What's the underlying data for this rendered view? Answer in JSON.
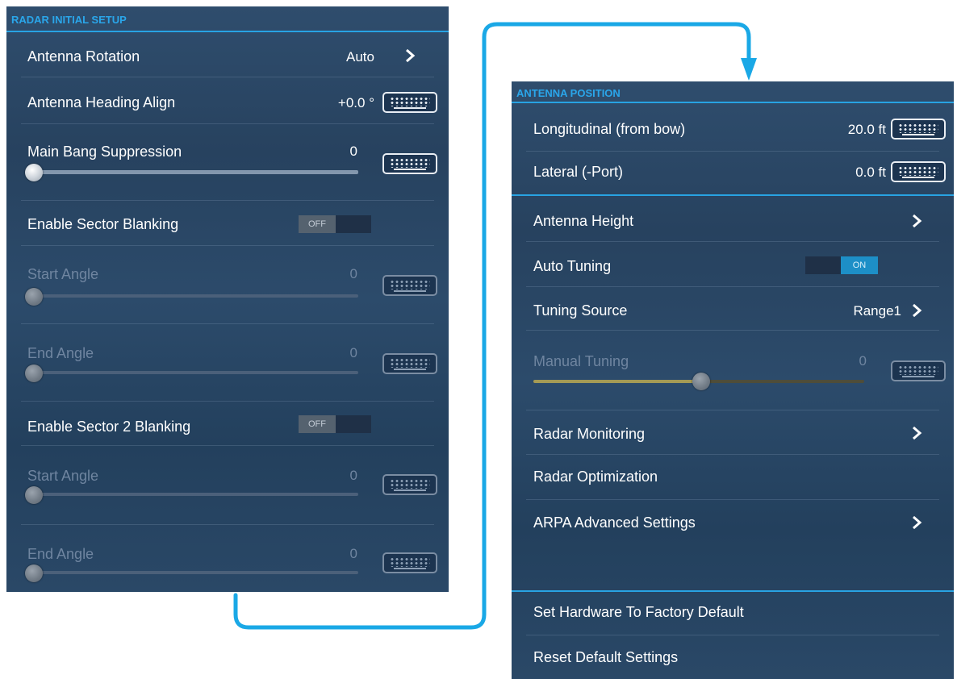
{
  "left_panel": {
    "title": "RADAR INITIAL SETUP",
    "antenna_rotation": {
      "label": "Antenna Rotation",
      "value": "Auto"
    },
    "antenna_heading_align": {
      "label": "Antenna Heading Align",
      "value": "+0.0 °"
    },
    "main_bang_suppression": {
      "label": "Main Bang Suppression",
      "value": "0"
    },
    "enable_sector_blanking": {
      "label": "Enable Sector Blanking",
      "toggle": "OFF"
    },
    "start_angle_1": {
      "label": "Start Angle",
      "value": "0"
    },
    "end_angle_1": {
      "label": "End Angle",
      "value": "0"
    },
    "enable_sector_2_blanking": {
      "label": "Enable Sector 2 Blanking",
      "toggle": "OFF"
    },
    "start_angle_2": {
      "label": "Start Angle",
      "value": "0"
    },
    "end_angle_2": {
      "label": "End Angle",
      "value": "0"
    }
  },
  "right_panel": {
    "title": "ANTENNA POSITION",
    "longitudinal": {
      "label": "Longitudinal (from bow)",
      "value": "20.0 ft"
    },
    "lateral": {
      "label": "Lateral (-Port)",
      "value": "0.0 ft"
    },
    "antenna_height": {
      "label": "Antenna Height"
    },
    "auto_tuning": {
      "label": "Auto Tuning",
      "toggle": "ON"
    },
    "tuning_source": {
      "label": "Tuning Source",
      "value": "Range1"
    },
    "manual_tuning": {
      "label": "Manual Tuning",
      "value": "0"
    },
    "radar_monitoring": {
      "label": "Radar Monitoring"
    },
    "radar_optimization": {
      "label": "Radar Optimization"
    },
    "arpa_advanced": {
      "label": "ARPA Advanced Settings"
    },
    "factory_default": {
      "label": "Set Hardware To Factory Default"
    },
    "reset_default": {
      "label": "Reset Default Settings"
    }
  },
  "colors": {
    "panel_bg": "#2a4767",
    "accent": "#28a3e3",
    "text": "#ffffff",
    "disabled_text": "#6f85a0",
    "toggle_on": "#1d8fc7",
    "connector": "#1aa8e6"
  },
  "icons": [
    "chevron-right-icon",
    "keyboard-icon",
    "slider-knob",
    "arrow-down-icon"
  ]
}
